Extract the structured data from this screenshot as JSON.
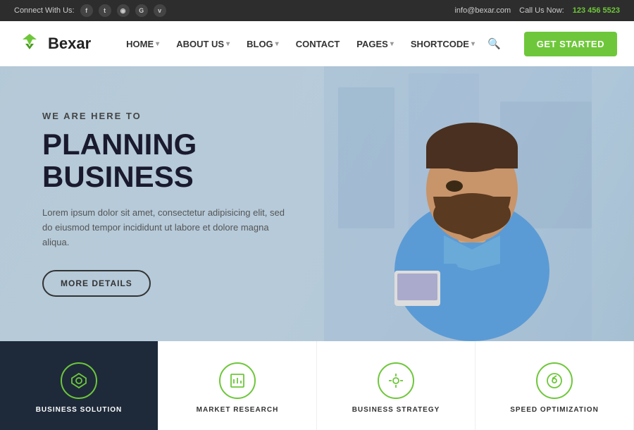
{
  "topbar": {
    "connect_label": "Connect With Us:",
    "email": "info@bexar.com",
    "call_label": "Call Us Now:",
    "phone": "123 456 5523",
    "social_icons": [
      "f",
      "t",
      "rss",
      "G",
      "v"
    ]
  },
  "header": {
    "logo_text": "Bexar",
    "nav_items": [
      {
        "label": "HOME",
        "has_dropdown": true
      },
      {
        "label": "ABOUT US",
        "has_dropdown": true
      },
      {
        "label": "BLOG",
        "has_dropdown": true
      },
      {
        "label": "CONTACT",
        "has_dropdown": false
      },
      {
        "label": "PAGES",
        "has_dropdown": true
      },
      {
        "label": "SHORTCODE",
        "has_dropdown": true
      }
    ],
    "get_started_label": "GET STARTED"
  },
  "hero": {
    "sub_label": "WE ARE HERE TO",
    "title": "PLANNING BUSINESS",
    "description": "Lorem ipsum dolor sit amet, consectetur adipisicing elit, sed do eiusmod tempor incididunt ut labore et dolore magna aliqua.",
    "btn_label": "MORE DETAILS"
  },
  "cards": [
    {
      "label": "BUSINESS SOLUTION",
      "icon": "◇"
    },
    {
      "label": "MARKET RESEARCH",
      "icon": "📊"
    },
    {
      "label": "BUSINESS STRATEGY",
      "icon": "💡"
    },
    {
      "label": "SPEED OPTIMIZATION",
      "icon": "🎯"
    }
  ]
}
